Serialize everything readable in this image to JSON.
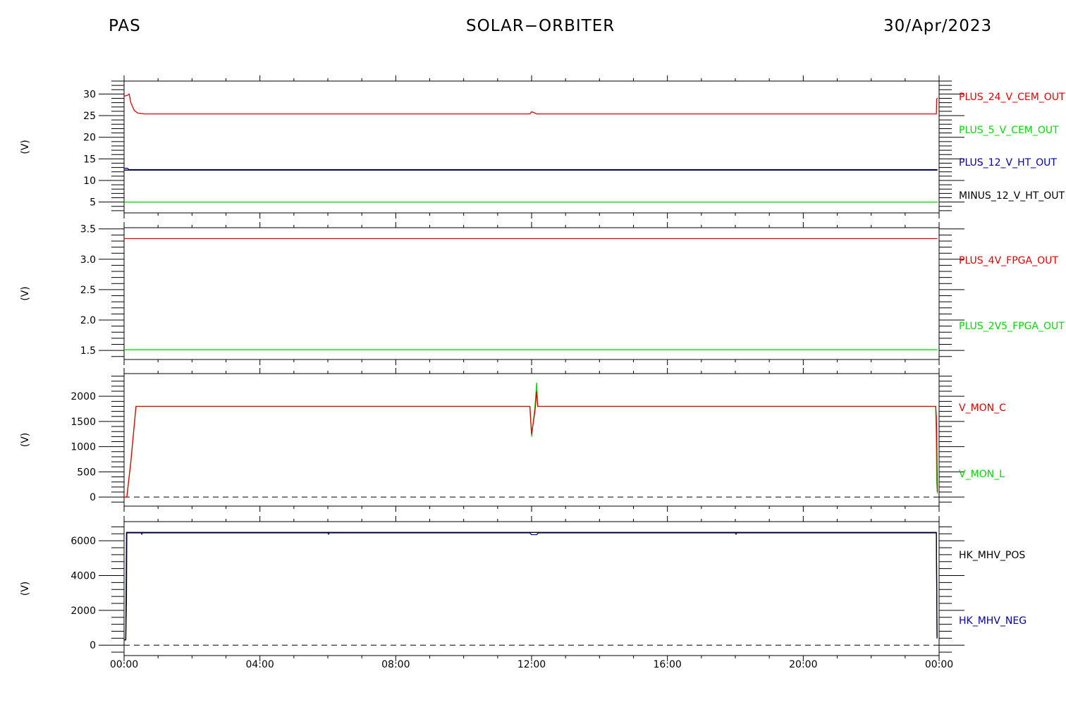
{
  "header": {
    "left": "PAS",
    "center": "SOLAR−ORBITER",
    "right": "30/Apr/2023"
  },
  "colors": {
    "red": "#e00000",
    "green": "#00dd00",
    "blue": "#0000a0",
    "black": "#000000"
  },
  "chart_data": [
    {
      "type": "line",
      "ylabel": "(V)",
      "ylim": [
        2.5,
        33
      ],
      "yticks": [
        5,
        10,
        15,
        20,
        25,
        30
      ],
      "ytick_labels": [
        "5",
        "10",
        "15",
        "20",
        "25",
        "30"
      ],
      "xlim": [
        0,
        24
      ],
      "series": [
        {
          "name": "PLUS_24_V_CEM_OUT",
          "color": "#e00000",
          "points": [
            [
              0,
              29.5
            ],
            [
              0.1,
              29.7
            ],
            [
              0.15,
              30
            ],
            [
              0.2,
              28
            ],
            [
              0.3,
              26.2
            ],
            [
              0.4,
              25.6
            ],
            [
              0.6,
              25.4
            ],
            [
              11.95,
              25.4
            ],
            [
              12.0,
              25.9
            ],
            [
              12.1,
              25.6
            ],
            [
              12.15,
              25.4
            ],
            [
              23.92,
              25.4
            ],
            [
              23.93,
              28.8
            ],
            [
              23.95,
              29.1
            ]
          ]
        },
        {
          "name": "PLUS_5_V_CEM_OUT",
          "color": "#00dd00",
          "points": [
            [
              0,
              5
            ],
            [
              23.95,
              5
            ]
          ]
        },
        {
          "name": "PLUS_12_V_HT_OUT",
          "color": "#0000a0",
          "points": [
            [
              0,
              12.8
            ],
            [
              0.1,
              12.8
            ],
            [
              0.15,
              12.5
            ],
            [
              23.95,
              12.5
            ]
          ]
        },
        {
          "name": "MINUS_12_V_HT_OUT",
          "color": "#000000",
          "points": [
            [
              0,
              12.4
            ],
            [
              23.95,
              12.4
            ]
          ]
        }
      ]
    },
    {
      "type": "line",
      "ylabel": "(V)",
      "ylim": [
        1.35,
        3.52
      ],
      "yticks": [
        1.5,
        2.0,
        2.5,
        3.0,
        3.5
      ],
      "ytick_labels": [
        "1.5",
        "2.0",
        "2.5",
        "3.0",
        "3.5"
      ],
      "xlim": [
        0,
        24
      ],
      "series": [
        {
          "name": "PLUS_4V_FPGA_OUT",
          "color": "#e00000",
          "points": [
            [
              0,
              3.34
            ],
            [
              23.95,
              3.34
            ]
          ]
        },
        {
          "name": "PLUS_2V5_FPGA_OUT",
          "color": "#00dd00",
          "points": [
            [
              0,
              1.51
            ],
            [
              23.95,
              1.51
            ]
          ]
        }
      ]
    },
    {
      "type": "line",
      "ylabel": "(V)",
      "ylim": [
        -180,
        2450
      ],
      "yticks": [
        0,
        500,
        1000,
        1500,
        2000
      ],
      "ytick_labels": [
        "0",
        "500",
        "1000",
        "1500",
        "2000"
      ],
      "zero_line": true,
      "xlim": [
        0,
        24
      ],
      "series": [
        {
          "name": "V_MON_C",
          "color": "#e00000",
          "points": [
            [
              0,
              0
            ],
            [
              0.08,
              0
            ],
            [
              0.2,
              700
            ],
            [
              0.35,
              1800
            ],
            [
              11.95,
              1800
            ],
            [
              12.0,
              1250
            ],
            [
              12.1,
              1700
            ],
            [
              12.15,
              2100
            ],
            [
              12.18,
              1800
            ],
            [
              23.9,
              1800
            ],
            [
              23.92,
              1600
            ],
            [
              23.93,
              1300
            ],
            [
              23.95,
              100
            ]
          ]
        },
        {
          "name": "V_MON_L",
          "color": "#00dd00",
          "points": [
            [
              0,
              0
            ],
            [
              0.08,
              0
            ],
            [
              0.2,
              700
            ],
            [
              0.35,
              1800
            ],
            [
              11.95,
              1800
            ],
            [
              12.0,
              1200
            ],
            [
              12.1,
              1800
            ],
            [
              12.15,
              2270
            ],
            [
              12.18,
              1800
            ],
            [
              23.9,
              1800
            ],
            [
              23.92,
              1000
            ],
            [
              23.93,
              300
            ],
            [
              23.95,
              70
            ]
          ]
        }
      ]
    },
    {
      "type": "line",
      "ylabel": "(V)",
      "ylim": [
        -600,
        7100
      ],
      "yticks": [
        0,
        2000,
        4000,
        6000
      ],
      "ytick_labels": [
        "0",
        "2000",
        "4000",
        "6000"
      ],
      "zero_line": true,
      "xlim": [
        0,
        24
      ],
      "xticks": [
        0,
        4,
        8,
        12,
        16,
        20,
        24
      ],
      "xtick_labels": [
        "00:00",
        "04:00",
        "08:00",
        "12:00",
        "16:00",
        "20:00",
        "00:00"
      ],
      "series": [
        {
          "name": "HK_MHV_POS",
          "color": "#000000",
          "points": [
            [
              0,
              300
            ],
            [
              0.05,
              300
            ],
            [
              0.07,
              6480
            ],
            [
              23.92,
              6480
            ],
            [
              23.94,
              400
            ],
            [
              23.95,
              400
            ]
          ]
        },
        {
          "name": "HK_MHV_NEG",
          "color": "#0000a0",
          "points": [
            [
              0,
              300
            ],
            [
              0.05,
              300
            ],
            [
              0.07,
              2700
            ],
            [
              0.08,
              6450
            ],
            [
              0.5,
              6450
            ],
            [
              0.52,
              6380
            ],
            [
              0.54,
              6450
            ],
            [
              6.0,
              6450
            ],
            [
              6.02,
              6380
            ],
            [
              6.04,
              6450
            ],
            [
              11.95,
              6450
            ],
            [
              12.0,
              6350
            ],
            [
              12.15,
              6350
            ],
            [
              12.2,
              6450
            ],
            [
              18.0,
              6450
            ],
            [
              18.02,
              6380
            ],
            [
              18.04,
              6450
            ],
            [
              23.92,
              6450
            ],
            [
              23.94,
              500
            ],
            [
              23.95,
              500
            ]
          ]
        }
      ]
    }
  ]
}
